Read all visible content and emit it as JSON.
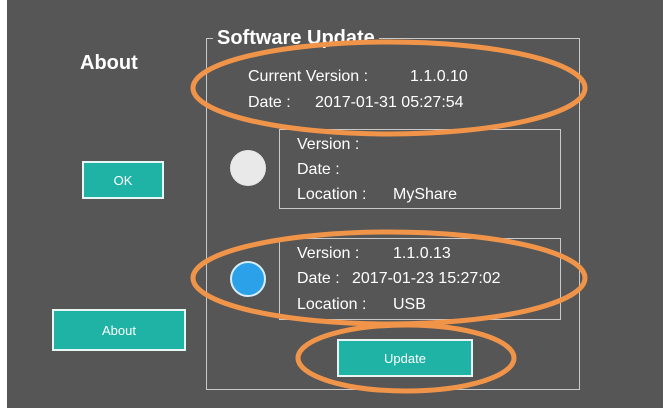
{
  "about_title": "About",
  "buttons": {
    "ok": "OK",
    "about": "About",
    "update": "Update"
  },
  "software_update": {
    "title": "Software Update",
    "current": {
      "version_label": "Current  Version :",
      "version_value": "1.1.0.10",
      "date_label": "Date :",
      "date_value": "2017-01-31 05:27:54"
    },
    "option1": {
      "version_label": "Version :",
      "version_value": "",
      "date_label": "Date :",
      "date_value": "",
      "location_label": "Location :",
      "location_value": "MyShare",
      "selected": false
    },
    "option2": {
      "version_label": "Version :",
      "version_value": "1.1.0.13",
      "date_label": "Date :",
      "date_value": "2017-01-23 15:27:02",
      "location_label": "Location :",
      "location_value": "USB",
      "selected": true
    }
  },
  "colors": {
    "background": "#565656",
    "accent": "#1fb3a5",
    "radio_selected": "#2aa1e8",
    "radio_unselected": "#e9e9e9",
    "highlight": "#f0944a"
  }
}
